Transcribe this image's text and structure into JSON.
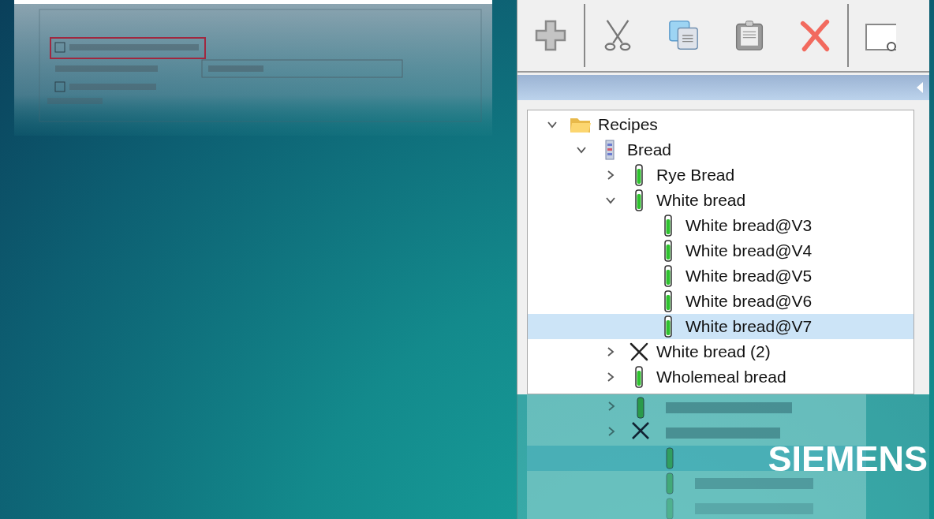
{
  "tree": [
    {
      "label": "Recipes",
      "kind": "folder",
      "expanded": true,
      "selected": false,
      "children": [
        {
          "label": "Bread",
          "kind": "group",
          "expanded": true,
          "selected": false,
          "children": [
            {
              "label": "Rye Bread",
              "kind": "recipe",
              "expanded": false,
              "selected": false
            },
            {
              "label": "White bread",
              "kind": "recipe",
              "expanded": true,
              "selected": false,
              "children": [
                {
                  "label": "White bread@V3",
                  "kind": "recipe",
                  "selected": false
                },
                {
                  "label": "White bread@V4",
                  "kind": "recipe",
                  "selected": false
                },
                {
                  "label": "White bread@V5",
                  "kind": "recipe",
                  "selected": false
                },
                {
                  "label": "White bread@V6",
                  "kind": "recipe",
                  "selected": false
                },
                {
                  "label": "White bread@V7",
                  "kind": "recipe",
                  "selected": true
                }
              ]
            },
            {
              "label": "White bread (2)",
              "kind": "deleted",
              "expanded": false,
              "selected": false
            },
            {
              "label": "Wholemeal bread",
              "kind": "recipe",
              "expanded": false,
              "selected": false
            }
          ]
        }
      ]
    }
  ],
  "logo": "SIEMENS"
}
